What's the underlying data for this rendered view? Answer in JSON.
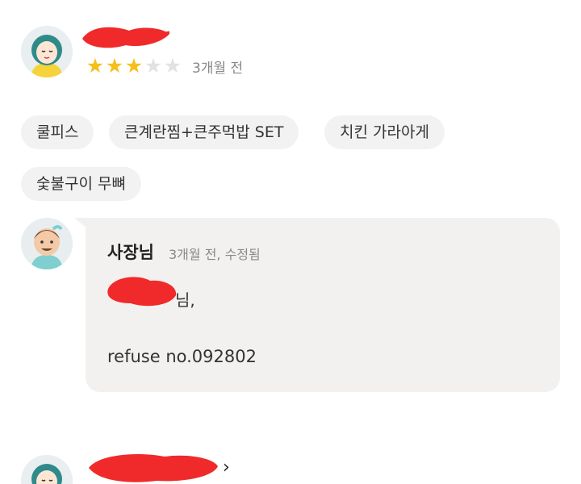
{
  "review": {
    "rating": 3,
    "max_rating": 5,
    "time": "3개월 전",
    "menu_tags": [
      "쿨피스",
      "큰계란찜+큰주먹밥 SET",
      "치킨 가라아게",
      "숯불구이 무뼈"
    ]
  },
  "owner_reply": {
    "name": "사장님",
    "meta": "3개월 전, 수정됨",
    "greeting_suffix": "님,",
    "body": "refuse no.092802"
  },
  "next_review": {
    "chevron": "›"
  },
  "colors": {
    "star_on": "#f5c01b",
    "star_off": "#e2e2e2",
    "chip_bg": "#f2f2f2",
    "bubble_bg": "#f3f1ef",
    "redaction": "#f02a2a"
  }
}
